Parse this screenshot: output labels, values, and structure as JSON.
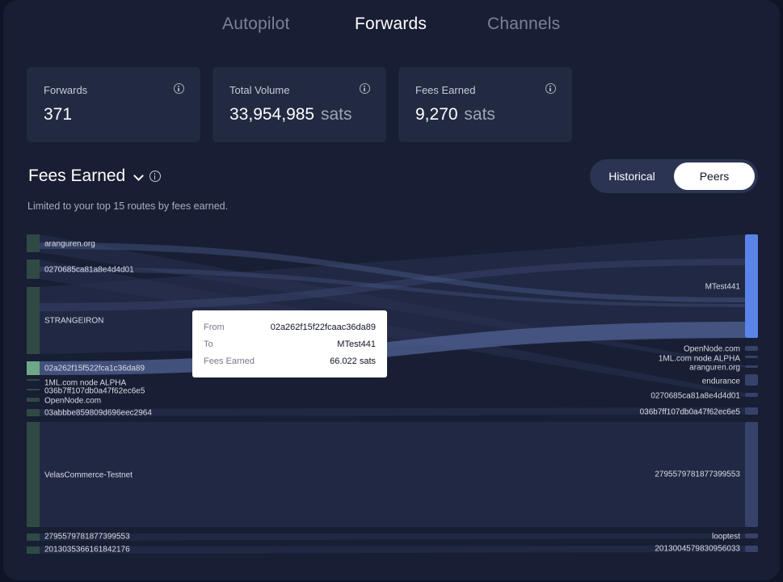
{
  "nav": {
    "tabs": [
      {
        "label": "Autopilot",
        "active": false
      },
      {
        "label": "Forwards",
        "active": true
      },
      {
        "label": "Channels",
        "active": false
      }
    ]
  },
  "stats": [
    {
      "label": "Forwards",
      "value": "371",
      "unit": ""
    },
    {
      "label": "Total Volume",
      "value": "33,954,985",
      "unit": "sats"
    },
    {
      "label": "Fees Earned",
      "value": "9,270",
      "unit": "sats"
    }
  ],
  "section": {
    "title": "Fees Earned",
    "subtitle": "Limited to your top 15 routes by fees earned.",
    "toggle": {
      "historical": "Historical",
      "peers": "Peers",
      "selected": "Peers"
    }
  },
  "sankey": {
    "sources": [
      "aranguren.org",
      "0270685ca81a8e4d4d01",
      "STRANGEIRON",
      "02a262f15f522fca1c36da89",
      "1ML.com node ALPHA",
      "036b7ff107db0a47f62ec6e5",
      "OpenNode.com",
      "03abbbe859809d696eec2964",
      "VelasCommerce-Testnet",
      "2795579781877399553",
      "2013035366161842176"
    ],
    "targets": [
      "MTest441",
      "OpenNode.com",
      "1ML.com node ALPHA",
      "aranguren.org",
      "endurance",
      "0270685ca81a8e4d4d01",
      "036b7ff107db0a47f62ec6e5",
      "2795579781877399553",
      "looptest",
      "2013004579830956033"
    ],
    "colors": {
      "source": "#2f4a44",
      "source_active": "#6ea887",
      "target": "#36426a",
      "target_active": "#5b84e8",
      "link": "#2a3250",
      "link_active": "#4a5a8a"
    }
  },
  "tooltip": {
    "from_label": "From",
    "from": "02a262f15f22fcaac36da89",
    "to_label": "To",
    "to": "MTest441",
    "fees_label": "Fees Earned",
    "fees": "66.022 sats"
  }
}
